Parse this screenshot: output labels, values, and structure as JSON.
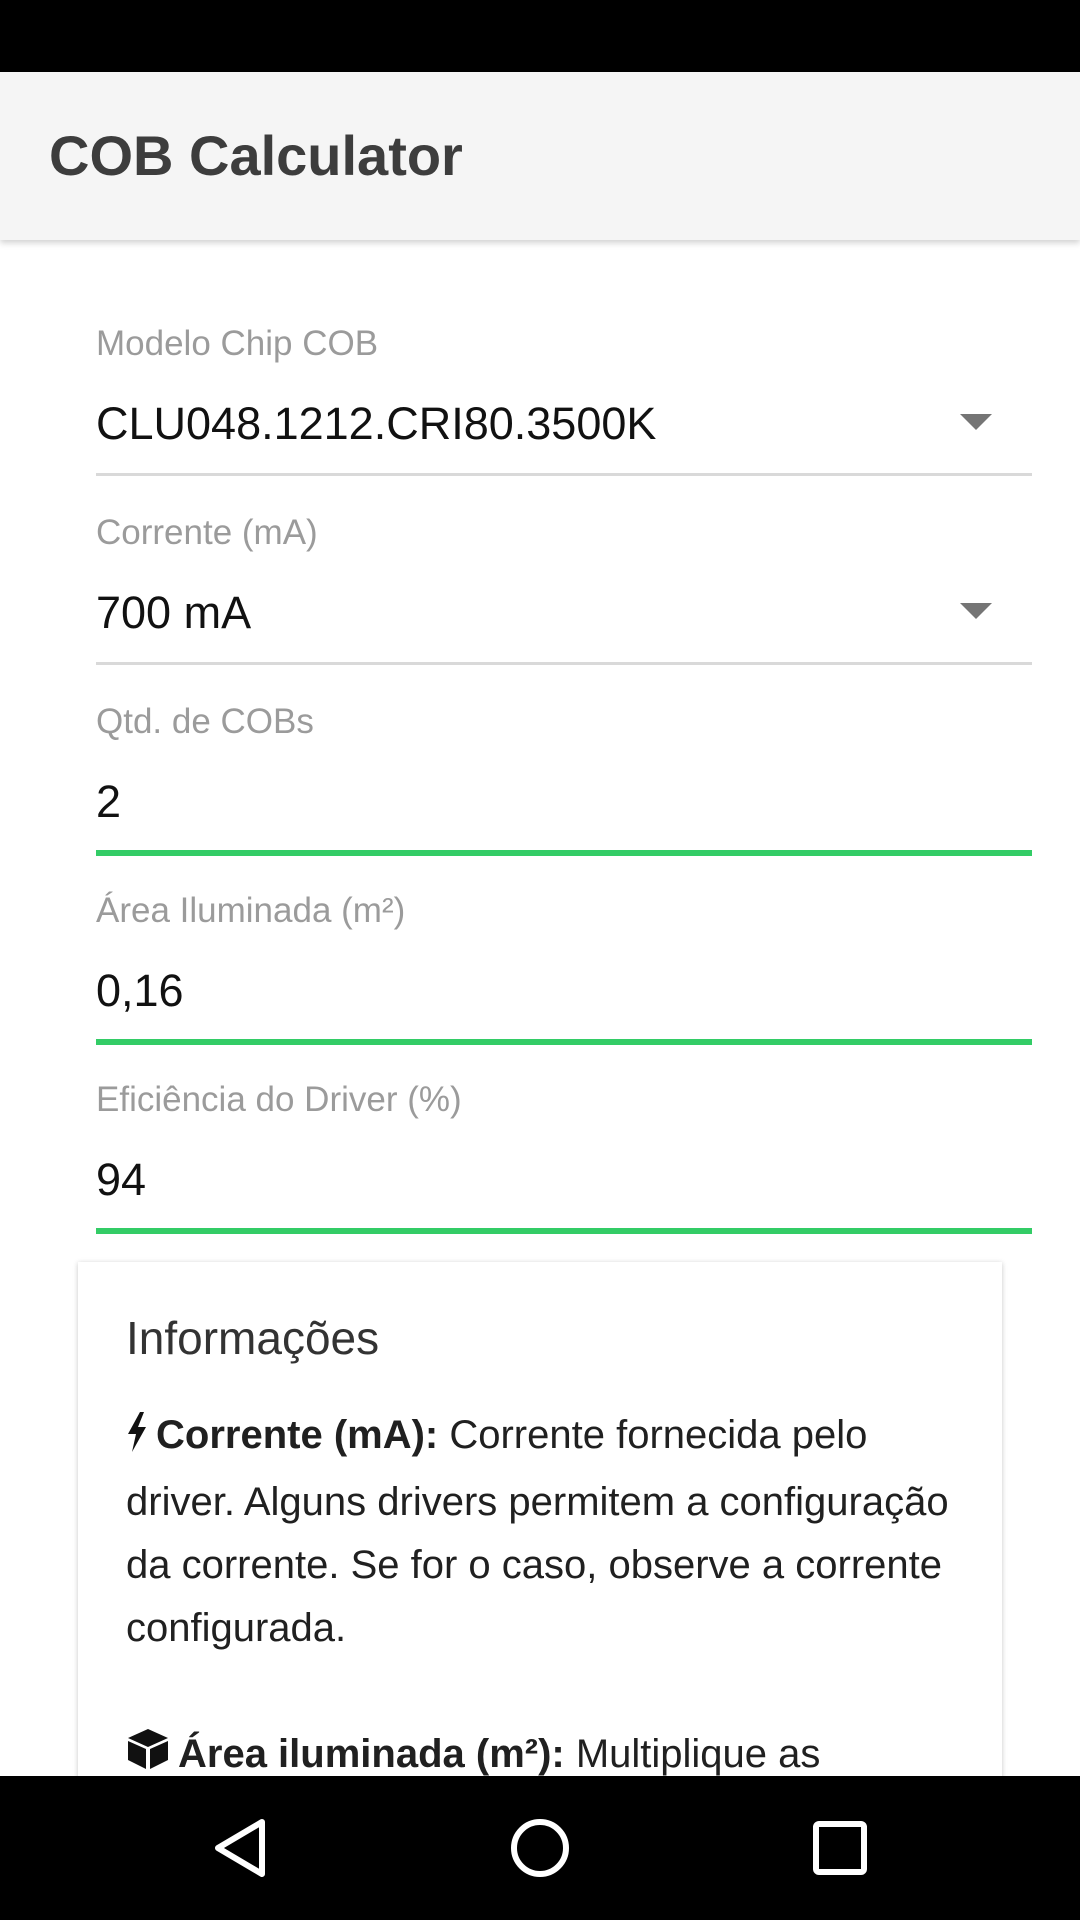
{
  "app": {
    "title": "COB Calculator"
  },
  "form": {
    "chip_model": {
      "label": "Modelo Chip COB",
      "value": "CLU048.1212.CRI80.3500K"
    },
    "current": {
      "label": "Corrente (mA)",
      "value": "700 mA"
    },
    "cob_qty": {
      "label": "Qtd. de COBs",
      "value": "2"
    },
    "area": {
      "label": "Área Iluminada (m²)",
      "value": "0,16"
    },
    "driver_eff": {
      "label": "Eficiência do Driver (%)",
      "value": "94"
    }
  },
  "info": {
    "title": "Informações",
    "items": [
      {
        "icon": "bolt-icon",
        "term": "Corrente (mA):",
        "text": " Corrente fornecida pelo driver. Alguns drivers permitem a configuração da corrente. Se for o caso, observe a corrente configurada."
      },
      {
        "icon": "cube-icon",
        "term": "Área iluminada (m²):",
        "text": " Multiplique as"
      }
    ]
  },
  "colors": {
    "accent": "#33cc66",
    "app_bar": "#f5f5f5",
    "label": "#9b9b9b"
  },
  "nav": {
    "back": "back-icon",
    "home": "home-icon",
    "recents": "recents-icon"
  }
}
